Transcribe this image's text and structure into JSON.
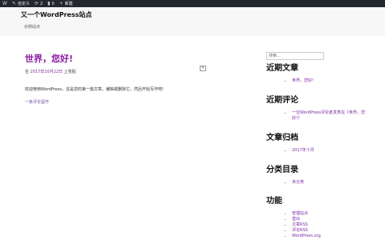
{
  "admin_bar": {
    "items": [
      {
        "icon": "wordpress-icon",
        "label": "",
        "glyph": "W"
      },
      {
        "icon": "paintbrush-icon",
        "label": "自定义",
        "glyph": "✎"
      },
      {
        "icon": "updates-icon",
        "label": "2",
        "glyph": "⟳"
      },
      {
        "icon": "comment-icon",
        "label": "0",
        "glyph": "▮"
      },
      {
        "icon": "plus-icon",
        "label": "新建",
        "glyph": "+"
      }
    ]
  },
  "site": {
    "title": "又一个WordPress站点",
    "description": "示例站点"
  },
  "post": {
    "title": "世界，您好!",
    "meta_prefix": "在",
    "date": "2017年10月22日",
    "meta_suffix": "上张贴",
    "body": "欢迎使用WordPress。这是您的第一篇文章。编辑或删除它，然后开始写作吧!",
    "comments_link": "一条评论留开"
  },
  "sidebar": {
    "search_placeholder": "搜索...",
    "recent_posts": {
      "title": "近期文章",
      "items": [
        "世界，您好!"
      ]
    },
    "recent_comments": {
      "title": "近期评论",
      "items": [
        "一位WordPress评论者发表在《世界，您好!》"
      ]
    },
    "archives": {
      "title": "文章归档",
      "items": [
        "2017年十月"
      ]
    },
    "categories": {
      "title": "分类目录",
      "items": [
        "未分类"
      ]
    },
    "meta": {
      "title": "功能",
      "items": [
        "管理站点",
        "登出",
        "文章RSS",
        "评论RSS",
        "WordPress.org"
      ]
    }
  }
}
